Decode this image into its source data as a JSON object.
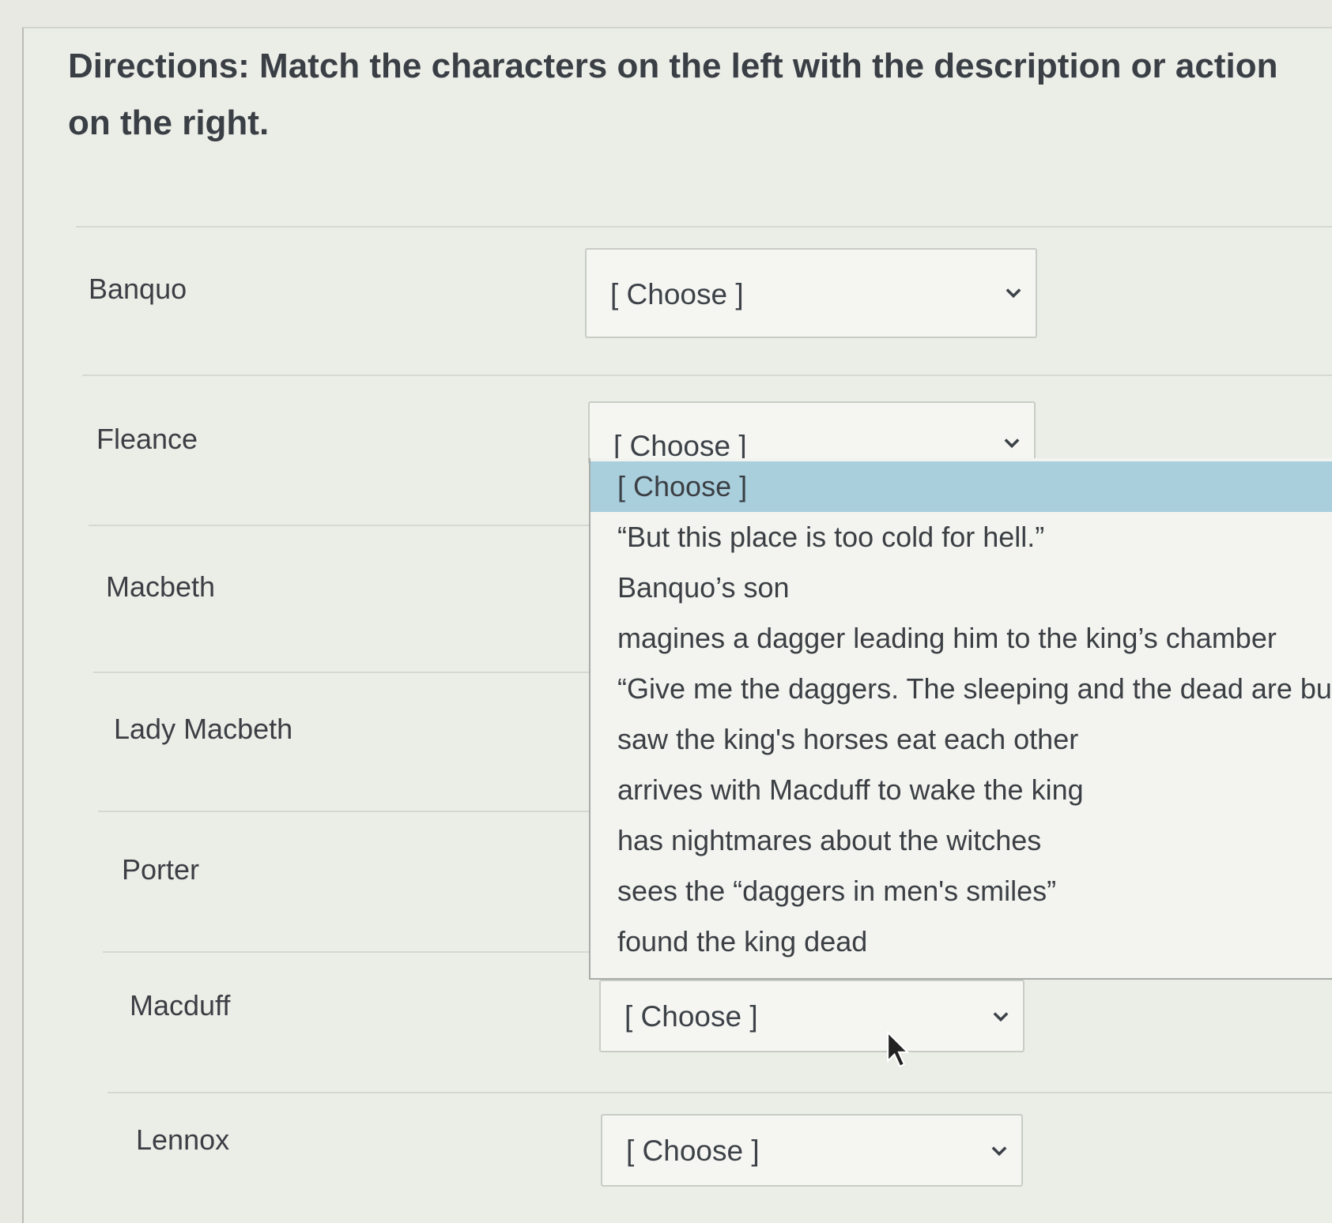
{
  "directions": "Directions: Match the characters on the left with the description or action on the right.",
  "placeholder": "[ Choose ]",
  "rows": [
    {
      "character": "Banquo",
      "selected": "[ Choose ]"
    },
    {
      "character": "Fleance",
      "selected": "[ Choose ]"
    },
    {
      "character": "Macbeth",
      "selected": ""
    },
    {
      "character": "Lady Macbeth",
      "selected": ""
    },
    {
      "character": "Porter",
      "selected": ""
    },
    {
      "character": "Macduff",
      "selected": "[ Choose ]"
    },
    {
      "character": "Lennox",
      "selected": "[ Choose ]"
    }
  ],
  "open_dropdown": {
    "row": "Fleance",
    "highlighted_index": 0,
    "options": [
      "[ Choose ]",
      "“But this place is too cold for hell.”",
      "Banquo’s son",
      "magines a dagger leading him to the king’s chamber",
      "“Give me the daggers. The sleeping and the dead are bu",
      "saw the king's horses eat each other",
      "arrives with Macduff to wake the king",
      "has nightmares about the witches",
      "sees the “daggers in men's smiles”",
      "found the king dead"
    ]
  },
  "icons": {
    "dropdown": "chevron-down-icon",
    "pointer": "mouse-cursor-icon"
  }
}
